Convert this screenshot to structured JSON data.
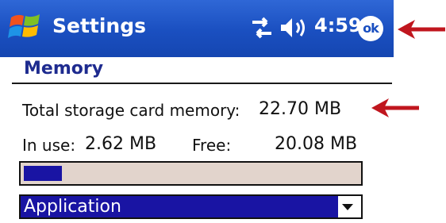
{
  "titlebar": {
    "title": "Settings",
    "time": "4:59",
    "ok_label": "ok"
  },
  "section": {
    "heading": "Memory"
  },
  "memory": {
    "total_label": "Total storage card memory:",
    "total_value": "22.70 MB",
    "in_use_label": "In use:",
    "in_use_value": "2.62 MB",
    "free_label": "Free:",
    "free_value": "20.08 MB",
    "usage_fraction": 0.115
  },
  "dropdown": {
    "selected": "Application"
  },
  "colors": {
    "titlebar": "#1a4fc0",
    "accent_blue": "#1914a3",
    "arrow_red": "#c0161e",
    "progress_bg": "#e2d4cc"
  },
  "icons": [
    "windows-start-icon",
    "connectivity-arrows-icon",
    "speaker-icon",
    "ok-icon",
    "annotation-arrow-icon"
  ]
}
